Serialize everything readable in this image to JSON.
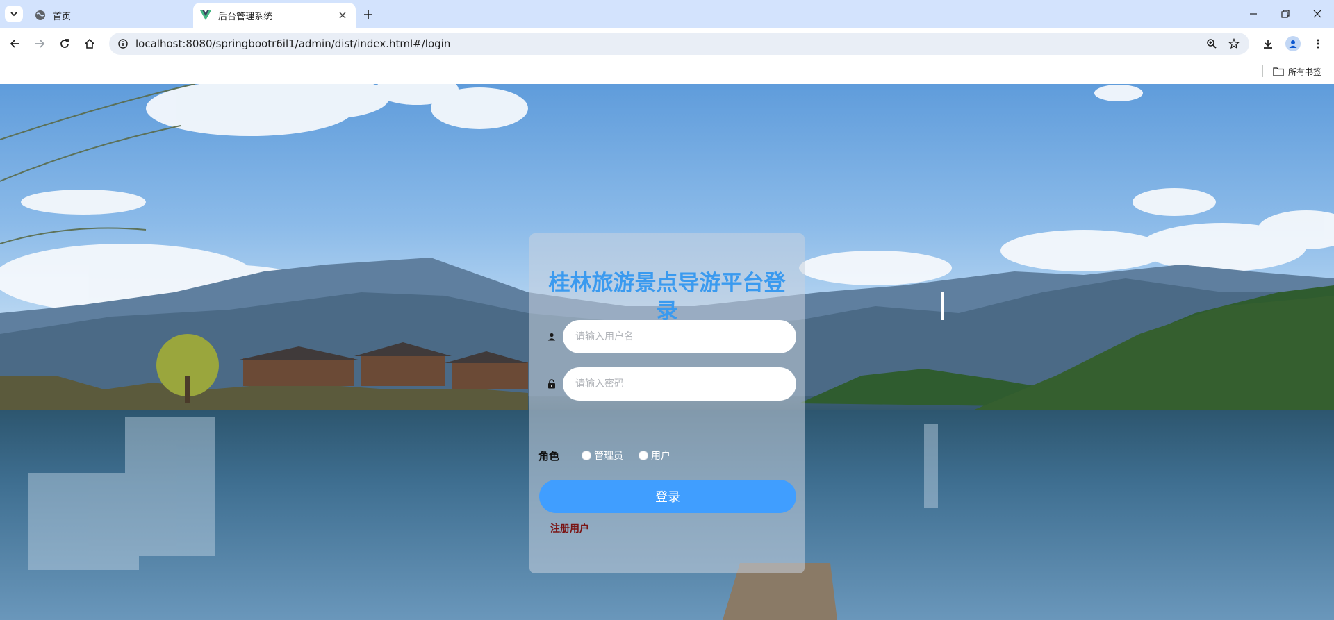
{
  "browser": {
    "tabs": [
      {
        "title": "首页",
        "active": false
      },
      {
        "title": "后台管理系统",
        "active": true
      }
    ],
    "url": "localhost:8080/springbootr6il1/admin/dist/index.html#/login",
    "bookmarks": {
      "all_label": "所有书签"
    }
  },
  "login": {
    "title": "桂林旅游景点导游平台登录",
    "username_placeholder": "请输入用户名",
    "password_placeholder": "请输入密码",
    "role_label": "角色",
    "roles": [
      "管理员",
      "用户"
    ],
    "submit_label": "登录",
    "register_label": "注册用户"
  },
  "colors": {
    "accent": "#409eff",
    "title": "#3a9aef",
    "register": "#7a1414",
    "tabbar": "#d3e3fd"
  }
}
